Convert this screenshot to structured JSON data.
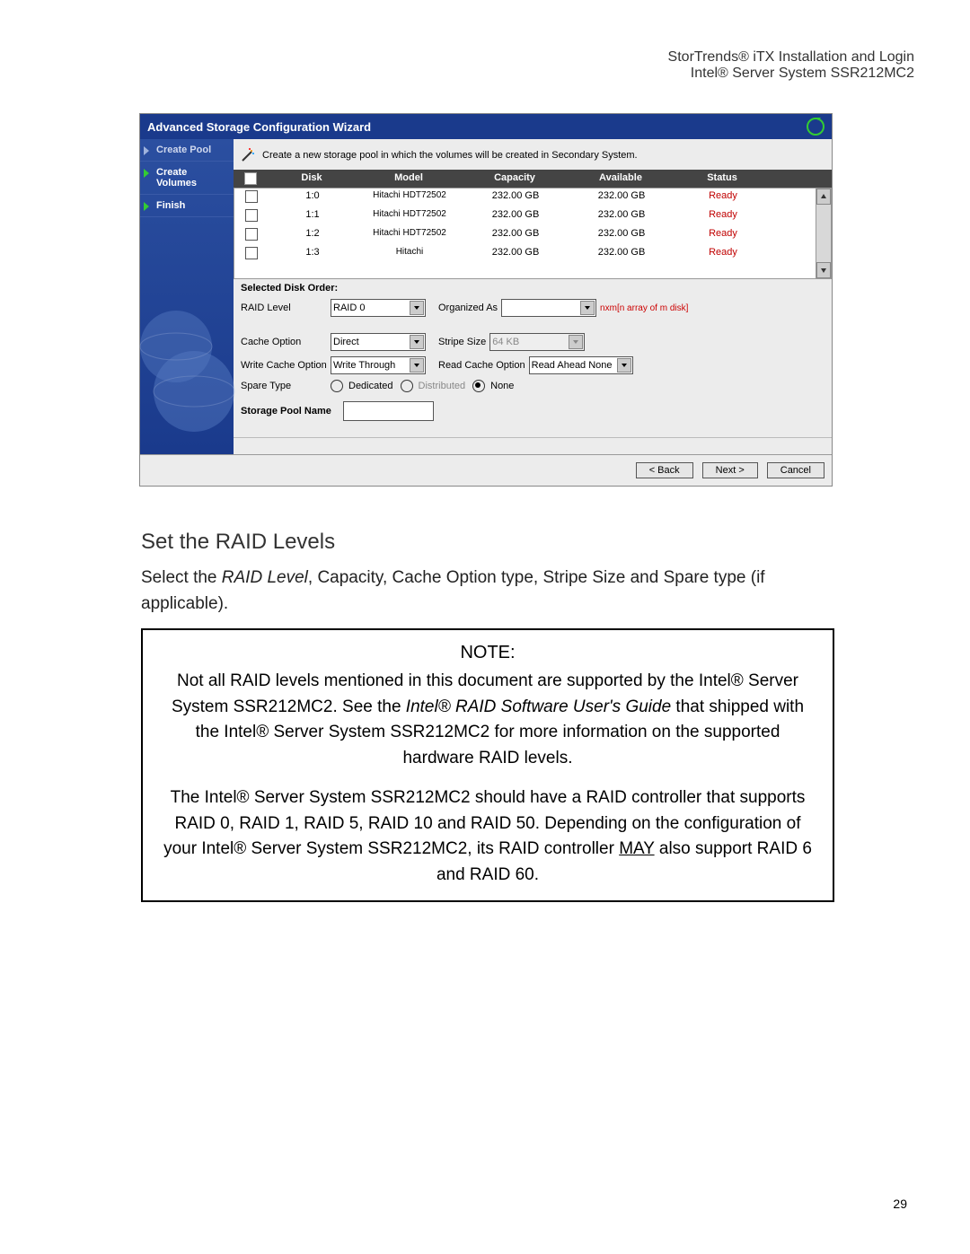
{
  "header": {
    "line1": "StorTrends® iTX Installation and Login",
    "line2": "Intel® Server System SSR212MC2"
  },
  "wizard": {
    "title": "Advanced Storage Configuration Wizard",
    "side": [
      {
        "label": "Create Pool",
        "active": false
      },
      {
        "label": "Create Volumes",
        "active": true
      },
      {
        "label": "Finish",
        "active": true
      }
    ],
    "instruction": "Create a new storage pool in which the volumes will be created in Secondary System.",
    "table": {
      "headers": {
        "disk": "Disk",
        "model": "Model",
        "capacity": "Capacity",
        "available": "Available",
        "status": "Status"
      },
      "rows": [
        {
          "disk": "1:0",
          "model": "Hitachi HDT72502",
          "capacity": "232.00 GB",
          "available": "232.00 GB",
          "status": "Ready"
        },
        {
          "disk": "1:1",
          "model": "Hitachi HDT72502",
          "capacity": "232.00 GB",
          "available": "232.00 GB",
          "status": "Ready"
        },
        {
          "disk": "1:2",
          "model": "Hitachi HDT72502",
          "capacity": "232.00 GB",
          "available": "232.00 GB",
          "status": "Ready"
        },
        {
          "disk": "1:3",
          "model": "Hitachi",
          "capacity": "232.00 GB",
          "available": "232.00 GB",
          "status": "Ready"
        }
      ]
    },
    "selected_disk_order": "Selected Disk Order:",
    "form": {
      "raid_level": {
        "label": "RAID Level",
        "value": "RAID 0"
      },
      "organized_as": {
        "label": "Organized As",
        "value": "",
        "hint": "nxm[n array of m disk]"
      },
      "cache_option": {
        "label": "Cache Option",
        "value": "Direct"
      },
      "stripe_size": {
        "label": "Stripe Size",
        "value": "64 KB"
      },
      "write_cache": {
        "label": "Write Cache Option",
        "value": "Write Through"
      },
      "read_cache": {
        "label": "Read Cache Option",
        "value": "Read Ahead None"
      },
      "spare_type": {
        "label": "Spare Type",
        "options": [
          "Dedicated",
          "Distributed",
          "None"
        ],
        "selected": "None"
      },
      "pool_name": {
        "label": "Storage Pool Name",
        "value": ""
      }
    },
    "buttons": {
      "back": "< Back",
      "next": "Next >",
      "cancel": "Cancel"
    }
  },
  "section_heading": "Set the RAID Levels",
  "paragraph": "Select the RAID Level, Capacity, Cache Option type, Stripe Size and Spare type (if applicable).",
  "note": {
    "title": "NOTE:",
    "p1": "Not all RAID levels mentioned in this document are supported by the Intel® Server System SSR212MC2. See the Intel® RAID Software User's Guide that shipped with the Intel® Server System SSR212MC2 for more information on the supported hardware RAID levels.",
    "p2": "The Intel® Server System SSR212MC2 should have a RAID controller that supports RAID 0, RAID 1, RAID 5, RAID 10 and RAID 50. Depending on the configuration of your Intel® Server System SSR212MC2, its RAID controller MAY also support RAID 6 and RAID 60."
  },
  "page_number": "29"
}
